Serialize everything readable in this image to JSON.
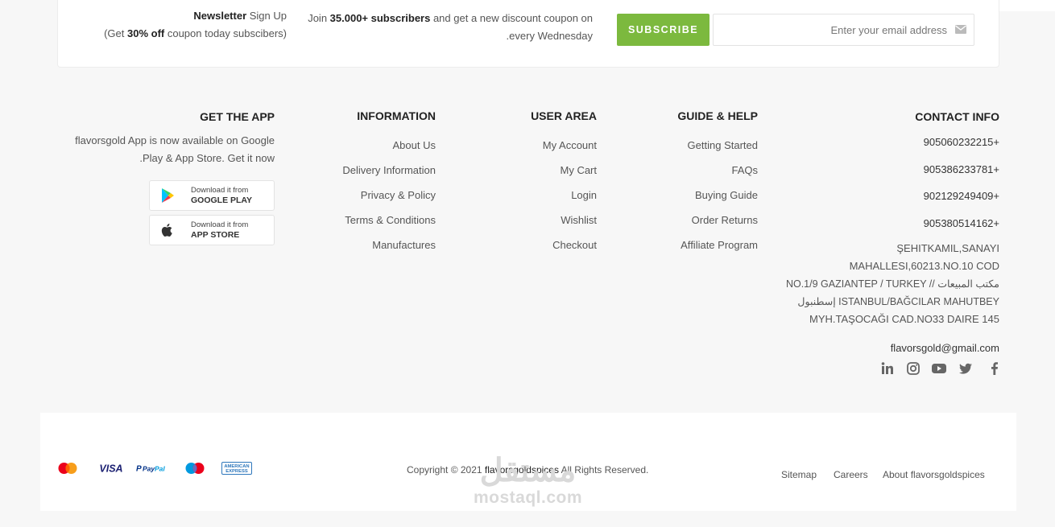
{
  "newsletter": {
    "title_bold": "Newsletter",
    "title_rest": " Sign Up",
    "sub_pre": "(Get ",
    "sub_bold": "30% off",
    "sub_post": " coupon today subscibers)",
    "join_pre": "Join ",
    "join_bold": "35.000+ subscribers",
    "join_post": " and get a new discount coupon on every Wednesday.",
    "subscribe_label": "SUBSCRIBE",
    "email_placeholder": "Enter your email address",
    "accent_color": "#7cb93e"
  },
  "get_app": {
    "title": "GET THE APP",
    "text_line1": "flavorsgold App is now available on Google",
    "text_line2": "Play & App Store. Get it now.",
    "google_play": {
      "line1": "Download it from",
      "line2": "GOOGLE PLAY",
      "icon": "google-play-icon"
    },
    "app_store": {
      "line1": "Download it from",
      "line2": "APP STORE",
      "icon": "apple-icon"
    }
  },
  "information": {
    "title": "INFORMATION",
    "links": [
      "About Us",
      "Delivery Information",
      "Privacy & Policy",
      "Terms & Conditions",
      "Manufactures"
    ]
  },
  "user_area": {
    "title": "USER AREA",
    "links": [
      "My Account",
      "My Cart",
      "Login",
      "Wishlist",
      "Checkout"
    ]
  },
  "guide_help": {
    "title": "GUIDE & HELP",
    "links": [
      "Getting Started",
      "FAQs",
      "Buying Guide",
      "Order Returns",
      "Affiliate Program"
    ]
  },
  "contact": {
    "title": "CONTACT INFO",
    "phones": [
      "905060232215+",
      "905386233781+",
      "902129249409+",
      "905380514162+"
    ],
    "address_lines": [
      "ŞEHITKAMIL,SANAYI",
      "MAHALLESI,60213.NO.10 COD",
      "NO.1/9 GAZIANTEP / TURKEY // مكتب المبيعات",
      "إسطنبول ISTANBUL/BAĞCILAR MAHUTBEY",
      "MYH.TAŞOCAĞI CAD.NO33 DAIRE 145"
    ],
    "email": "flavorsgold@gmail.com",
    "social": [
      "linkedin-icon",
      "instagram-icon",
      "youtube-icon",
      "twitter-icon",
      "facebook-icon"
    ]
  },
  "bottom": {
    "payments": [
      "MasterCard",
      "VISA",
      "PayPal",
      "Maestro",
      "AMERICAN EXPRESS"
    ],
    "copyright_pre": "Copyright © 2021 ",
    "copyright_brand": "flavorsgoldspices",
    "copyright_post": " All Rights Reserved.",
    "links": [
      "Sitemap",
      "Careers",
      "About flavorsgoldspices"
    ]
  },
  "watermark": {
    "arabic": "مستقل",
    "latin": "mostaql.com"
  }
}
